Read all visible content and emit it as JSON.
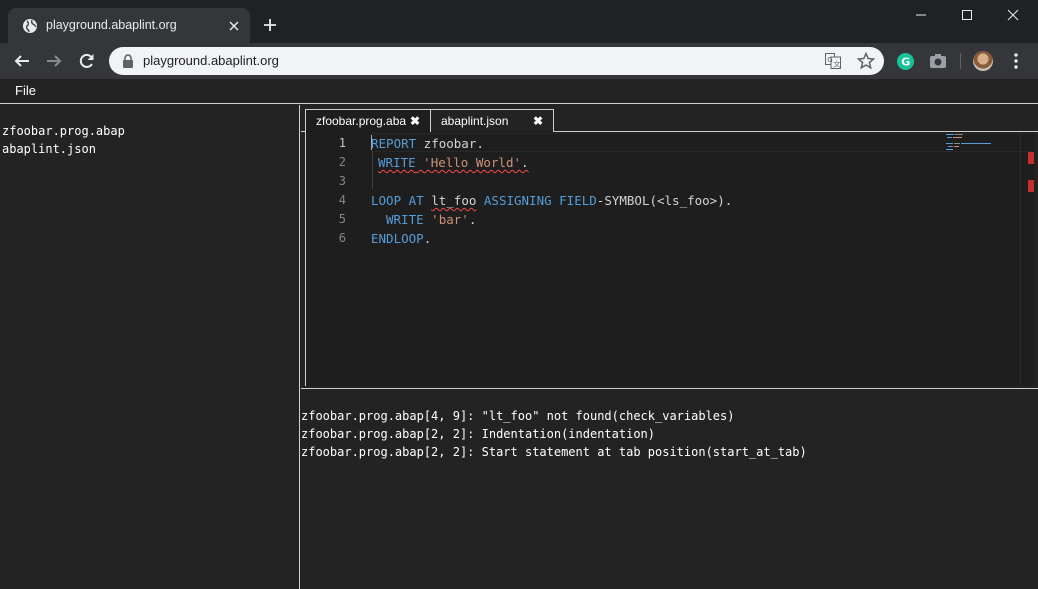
{
  "browser": {
    "tab_title": "playground.abaplint.org",
    "url": "playground.abaplint.org"
  },
  "app": {
    "menu": {
      "file_label": "File"
    },
    "files": [
      "zfoobar.prog.abap",
      "abaplint.json"
    ],
    "editor_tabs": [
      {
        "label": "zfoobar.prog.aba",
        "close": "✖"
      },
      {
        "label": "abaplint.json",
        "close": "✖"
      }
    ],
    "line_numbers": [
      "1",
      "2",
      "3",
      "4",
      "5",
      "6"
    ],
    "code": {
      "l1_kw": "REPORT",
      "l1_rest": " zfoobar.",
      "l2_kw": "WRITE",
      "l2_space": " ",
      "l2_str": "'Hello World'",
      "l2_dot": ".",
      "l4_kw1": "LOOP AT",
      "l4_space": " ",
      "l4_var": "lt_foo",
      "l4_kw2": " ASSIGNING FIELD",
      "l4_rest": "-SYMBOL(<ls_foo>).",
      "l5_kw": "WRITE",
      "l5_space": " ",
      "l5_str": "'bar'",
      "l5_dot": ".",
      "l6_kw": "ENDLOOP",
      "l6_dot": "."
    },
    "output": [
      "zfoobar.prog.abap[4, 9]: \"lt_foo\" not found(check_variables)",
      "zfoobar.prog.abap[2, 2]: Indentation(indentation)",
      "zfoobar.prog.abap[2, 2]: Start statement at tab position(start_at_tab)"
    ]
  },
  "colors": {
    "keyword": "#569cd6",
    "string": "#ce9178",
    "error": "#c72e2e"
  }
}
